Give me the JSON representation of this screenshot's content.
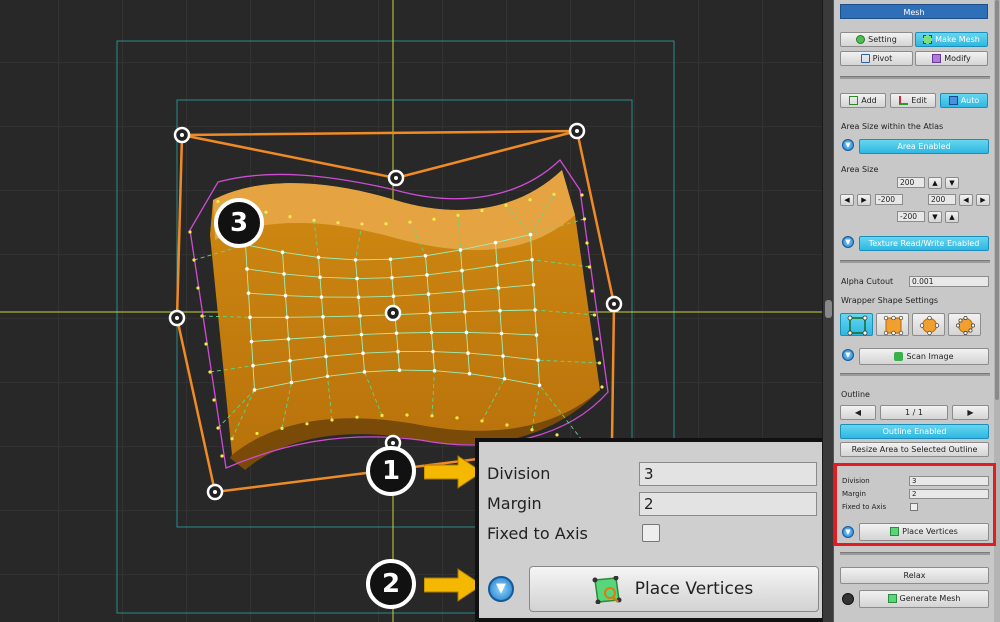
{
  "panel": {
    "title": "Mesh",
    "tabs": {
      "setting": "Setting",
      "make_mesh": "Make Mesh",
      "pivot": "Pivot",
      "modify": "Modify"
    },
    "modes": {
      "add": "Add",
      "edit": "Edit",
      "auto": "Auto"
    },
    "area_atlas_label": "Area Size within the Atlas",
    "area_enabled": "Area Enabled",
    "area_size_label": "Area Size",
    "area_top": "200",
    "area_left": "-200",
    "area_right": "200",
    "area_bottom": "-200",
    "texture_rw": "Texture Read/Write Enabled",
    "alpha_cutout_label": "Alpha Cutout",
    "alpha_cutout_value": "0.001",
    "wrapper_label": "Wrapper Shape Settings",
    "scan_image": "Scan Image",
    "outline_label": "Outline",
    "outline_page": "1 / 1",
    "outline_enabled": "Outline Enabled",
    "resize_area": "Resize Area to Selected Outline",
    "division_label": "Division",
    "division_value": "3",
    "margin_label": "Margin",
    "margin_value": "2",
    "fixed_axis_label": "Fixed to Axis",
    "place_vertices": "Place Vertices",
    "relax": "Relax",
    "generate_mesh": "Generate Mesh"
  },
  "callout": {
    "division_label": "Division",
    "division_value": "3",
    "margin_label": "Margin",
    "margin_value": "2",
    "fixed_axis_label": "Fixed to Axis",
    "place_vertices": "Place Vertices"
  },
  "badges": {
    "one": "1",
    "two": "2",
    "three": "3"
  },
  "colors": {
    "accent": "#2fb7e2",
    "highlight_box": "#e21d22",
    "wrapper": "#f08a24",
    "mesh": "#9cf0b8",
    "axis": "#d8e84a"
  }
}
